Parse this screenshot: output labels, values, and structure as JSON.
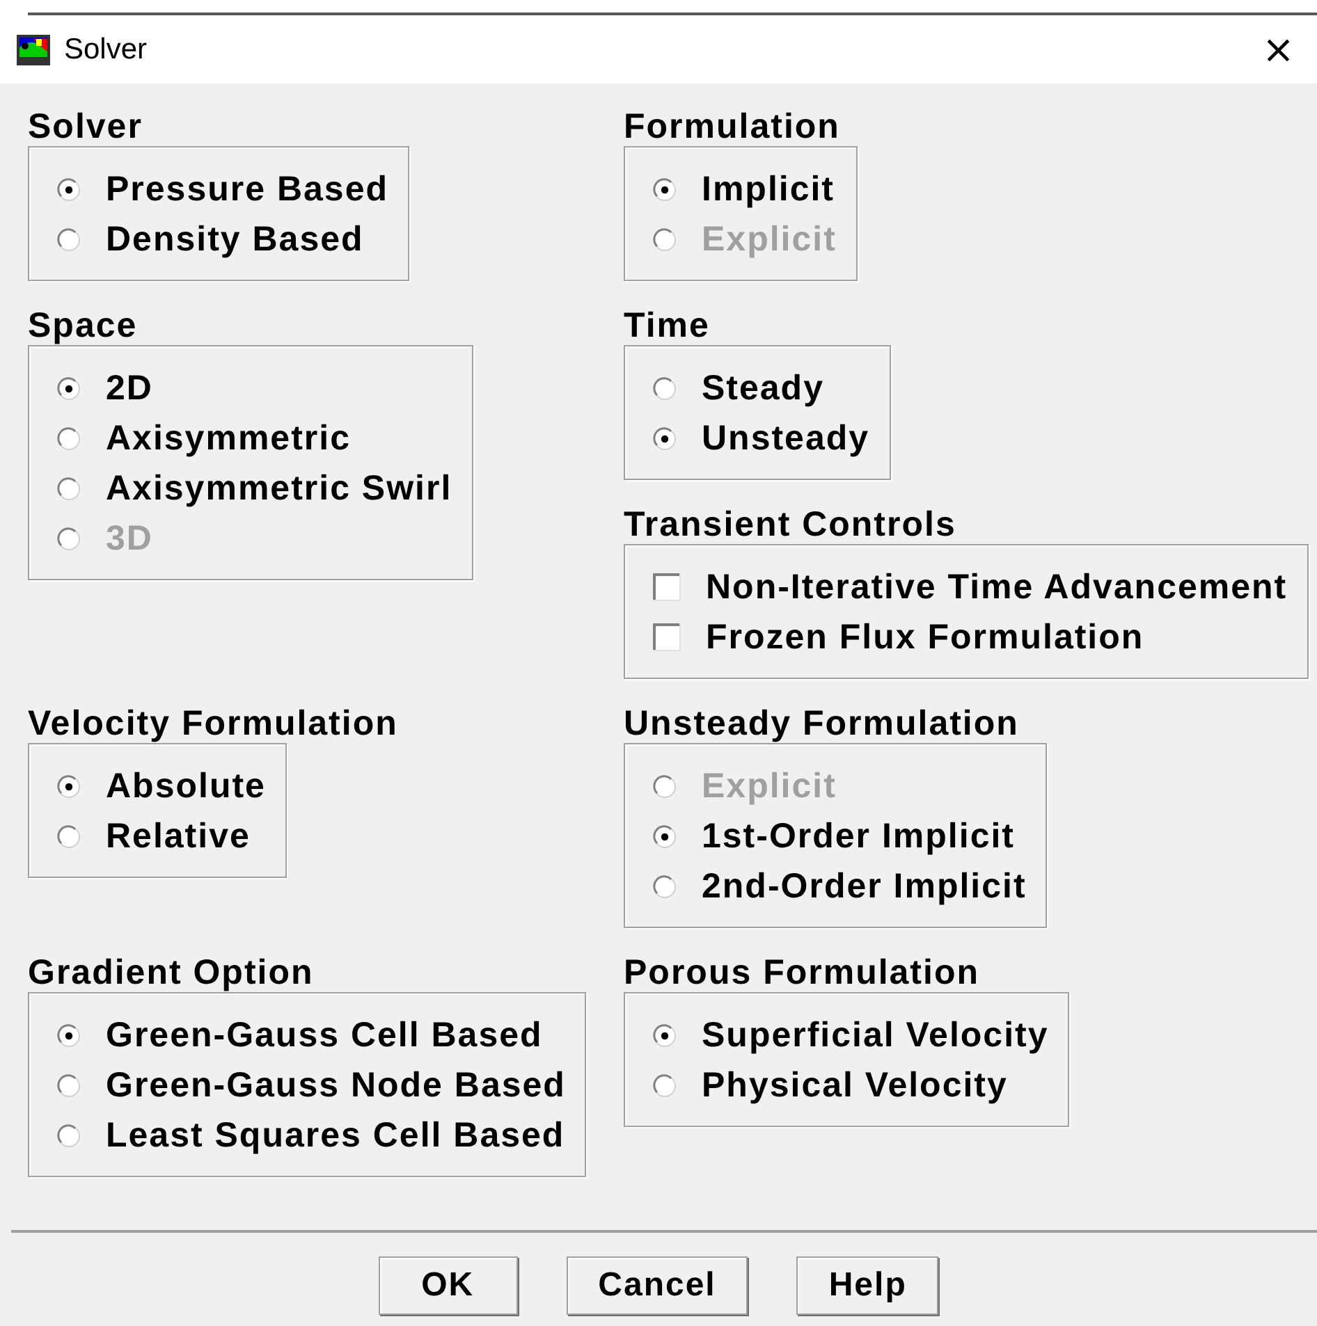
{
  "window": {
    "title": "Solver",
    "close": "×"
  },
  "rows": [
    {
      "left": [
        {
          "title": "Solver",
          "kind": "radio",
          "options": [
            {
              "label": "Pressure Based",
              "selected": true,
              "disabled": false
            },
            {
              "label": "Density Based",
              "selected": false,
              "disabled": false
            }
          ]
        }
      ],
      "right": [
        {
          "title": "Formulation",
          "kind": "radio",
          "options": [
            {
              "label": "Implicit",
              "selected": true,
              "disabled": false
            },
            {
              "label": "Explicit",
              "selected": false,
              "disabled": true
            }
          ]
        }
      ]
    },
    {
      "left": [
        {
          "title": "Space",
          "kind": "radio",
          "options": [
            {
              "label": "2D",
              "selected": true,
              "disabled": false
            },
            {
              "label": "Axisymmetric",
              "selected": false,
              "disabled": false
            },
            {
              "label": "Axisymmetric Swirl",
              "selected": false,
              "disabled": false
            },
            {
              "label": "3D",
              "selected": false,
              "disabled": true
            }
          ]
        }
      ],
      "right": [
        {
          "title": "Time",
          "kind": "radio",
          "options": [
            {
              "label": "Steady",
              "selected": false,
              "disabled": false
            },
            {
              "label": "Unsteady",
              "selected": true,
              "disabled": false
            }
          ]
        },
        {
          "title": "Transient Controls",
          "kind": "checkbox",
          "options": [
            {
              "label": "Non-Iterative Time Advancement",
              "checked": false,
              "disabled": false
            },
            {
              "label": "Frozen Flux Formulation",
              "checked": false,
              "disabled": false
            }
          ]
        }
      ]
    },
    {
      "left": [
        {
          "title": "Velocity Formulation",
          "kind": "radio",
          "options": [
            {
              "label": "Absolute",
              "selected": true,
              "disabled": false
            },
            {
              "label": "Relative",
              "selected": false,
              "disabled": false
            }
          ]
        }
      ],
      "right": [
        {
          "title": "Unsteady Formulation",
          "kind": "radio",
          "options": [
            {
              "label": "Explicit",
              "selected": false,
              "disabled": true
            },
            {
              "label": "1st-Order Implicit",
              "selected": true,
              "disabled": false
            },
            {
              "label": "2nd-Order Implicit",
              "selected": false,
              "disabled": false
            }
          ]
        }
      ]
    },
    {
      "left": [
        {
          "title": "Gradient Option",
          "kind": "radio",
          "options": [
            {
              "label": "Green-Gauss Cell Based",
              "selected": true,
              "disabled": false
            },
            {
              "label": "Green-Gauss Node Based",
              "selected": false,
              "disabled": false
            },
            {
              "label": "Least Squares Cell Based",
              "selected": false,
              "disabled": false
            }
          ]
        }
      ],
      "right": [
        {
          "title": "Porous Formulation",
          "kind": "radio",
          "options": [
            {
              "label": "Superficial Velocity",
              "selected": true,
              "disabled": false
            },
            {
              "label": "Physical Velocity",
              "selected": false,
              "disabled": false
            }
          ]
        }
      ]
    }
  ],
  "buttons": [
    "OK",
    "Cancel",
    "Help"
  ]
}
